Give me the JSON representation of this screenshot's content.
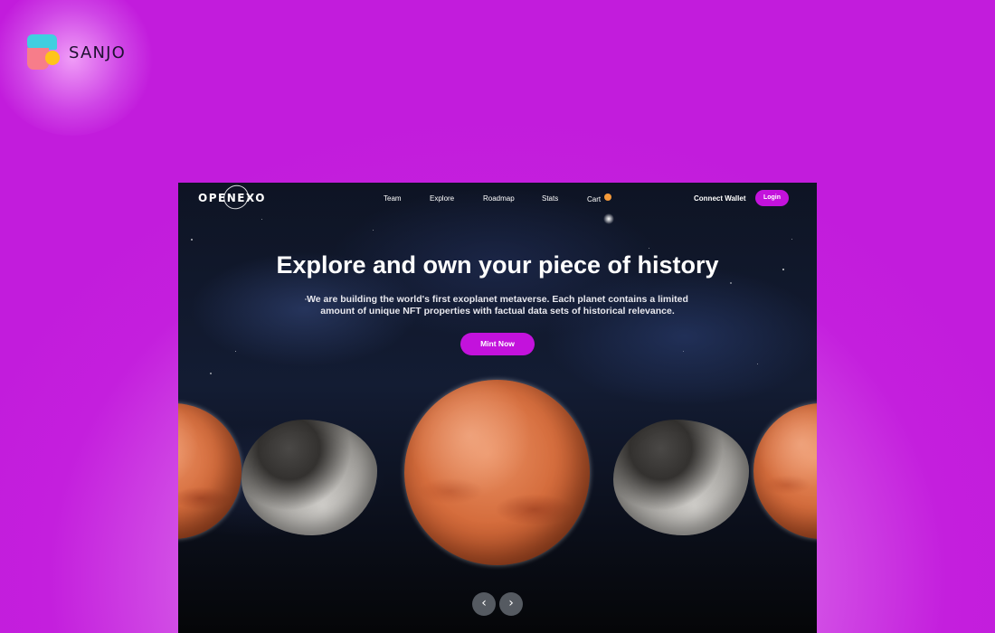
{
  "brand": {
    "name": "SANJO"
  },
  "site": {
    "logo": "OPENEXO",
    "nav": {
      "items": [
        "Team",
        "Explore",
        "Roadmap",
        "Stats",
        "Cart"
      ],
      "connect_wallet": "Connect Wallet",
      "login": "Login"
    },
    "hero": {
      "title": "Explore and own your piece of history",
      "subtitle_line1": "We are building the world's first exoplanet metaverse. Each planet contains a limited",
      "subtitle_line2": "amount of unique NFT properties with factual data sets of historical relevance.",
      "cta": "Mint Now"
    },
    "carousel": {
      "prev_icon": "chevron-left-icon",
      "next_icon": "chevron-right-icon",
      "slides": [
        "mars",
        "moon",
        "mars",
        "moon",
        "mars"
      ]
    }
  },
  "colors": {
    "background": "#c21cdc",
    "accent": "#c312dc",
    "cart_badge": "#f59a3a",
    "logo_cyan": "#3fcfe0",
    "logo_pink": "#f77d8a",
    "logo_yellow": "#ffc41a"
  }
}
